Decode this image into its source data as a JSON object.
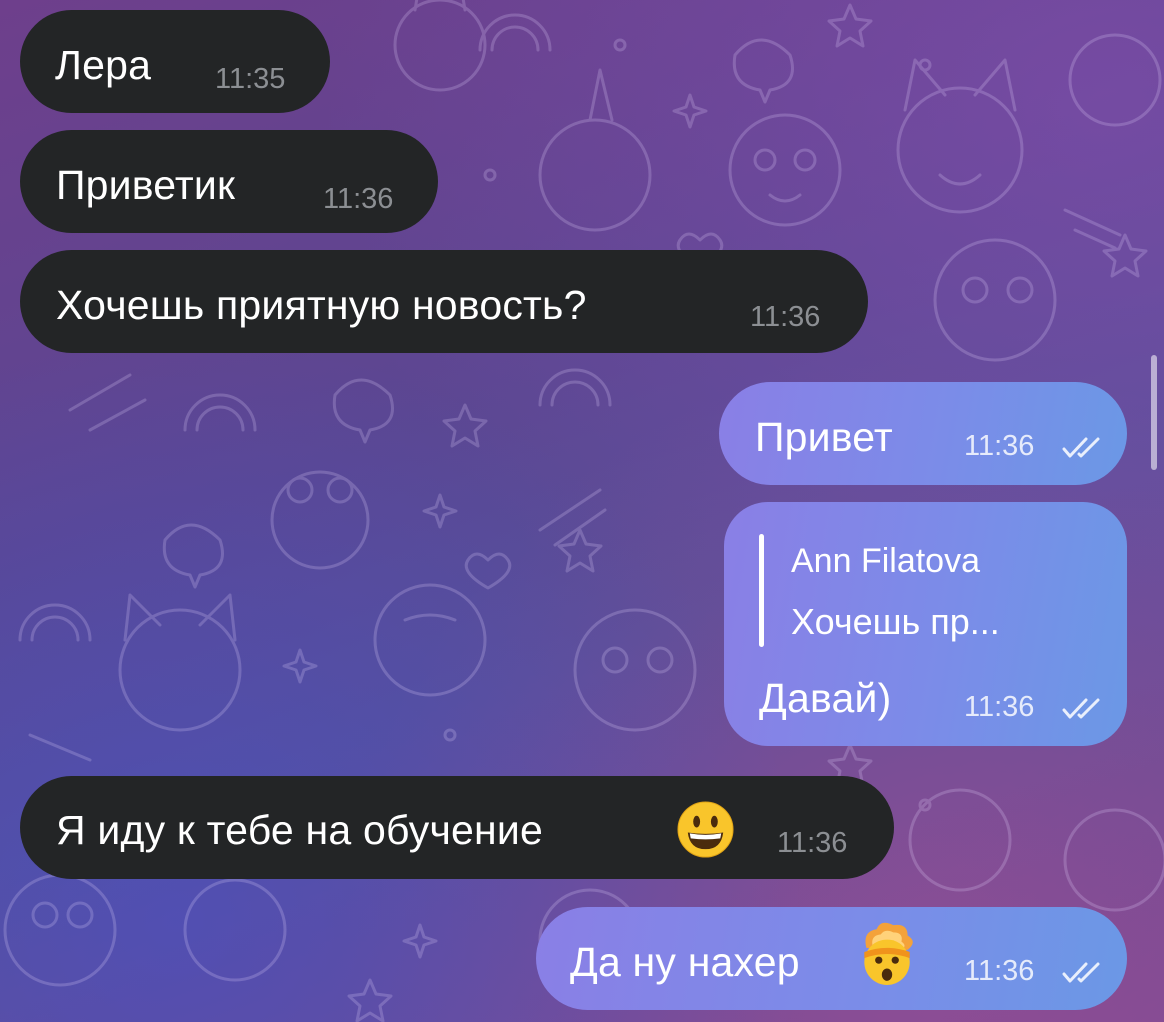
{
  "chat": {
    "messages": [
      {
        "direction": "incoming",
        "text": "Лера",
        "time": "11:35"
      },
      {
        "direction": "incoming",
        "text": "Приветик",
        "time": "11:36"
      },
      {
        "direction": "incoming",
        "text": "Хочешь приятную новость?",
        "time": "11:36"
      },
      {
        "direction": "outgoing",
        "text": "Привет",
        "time": "11:36",
        "status_icon": "double-check-icon"
      },
      {
        "direction": "outgoing",
        "reply": {
          "author": "Ann Filatova",
          "text": "Хочешь пр..."
        },
        "text": "Давай)",
        "time": "11:36",
        "status_icon": "double-check-icon"
      },
      {
        "direction": "incoming",
        "text": "Я иду к тебе на обучение",
        "emoji": "grinning-face-emoji",
        "time": "11:36"
      },
      {
        "direction": "outgoing",
        "text": "Да ну нахер",
        "emoji": "exploding-head-emoji",
        "time": "11:36",
        "status_icon": "double-check-icon"
      }
    ]
  },
  "colors": {
    "incoming_bubble": "#232526",
    "outgoing_bubble_start": "#8a7fe6",
    "outgoing_bubble_end": "#6b98e6",
    "background_start": "#6e3f8c",
    "background_end": "#584f98"
  }
}
